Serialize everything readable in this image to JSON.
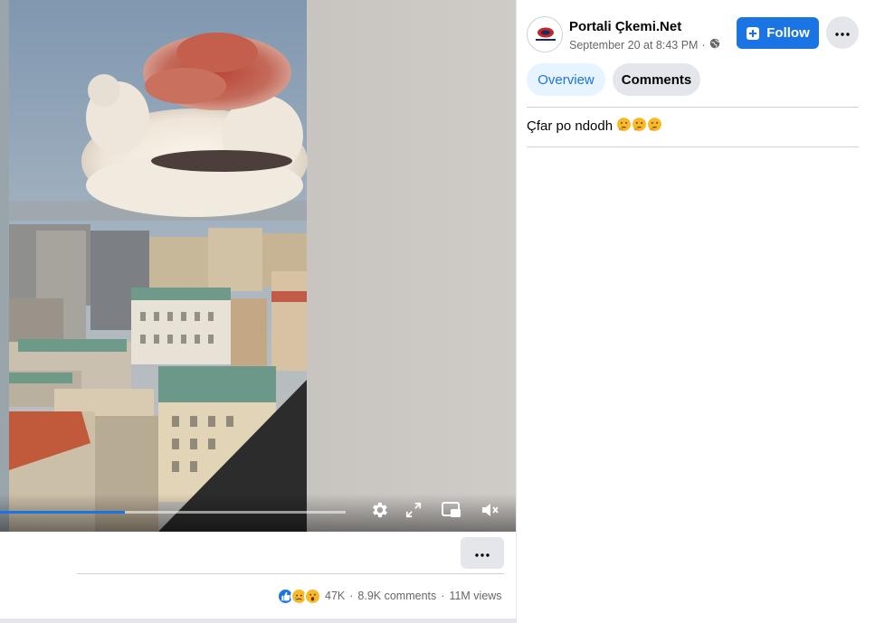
{
  "video": {
    "progress_fraction": 0.36
  },
  "post": {
    "page_name": "Portali Çkemi.Net",
    "timestamp": "September 20 at 8:43 PM",
    "audience_icon": "globe-icon",
    "follow_label": "Follow",
    "text": "Çfar po ndodh",
    "text_emojis": [
      "thinking-face",
      "thinking-face",
      "thinking-face"
    ]
  },
  "tabs": {
    "overview": "Overview",
    "comments": "Comments"
  },
  "stats": {
    "reactions": [
      "like",
      "sad",
      "wow"
    ],
    "reaction_count": "47K",
    "comments": "8.9K comments",
    "views": "11M views"
  },
  "colors": {
    "brand": "#1b74e4",
    "button_gray": "#e4e6eb",
    "tab_active_bg": "#e7f3ff",
    "text_secondary": "#65676b"
  }
}
